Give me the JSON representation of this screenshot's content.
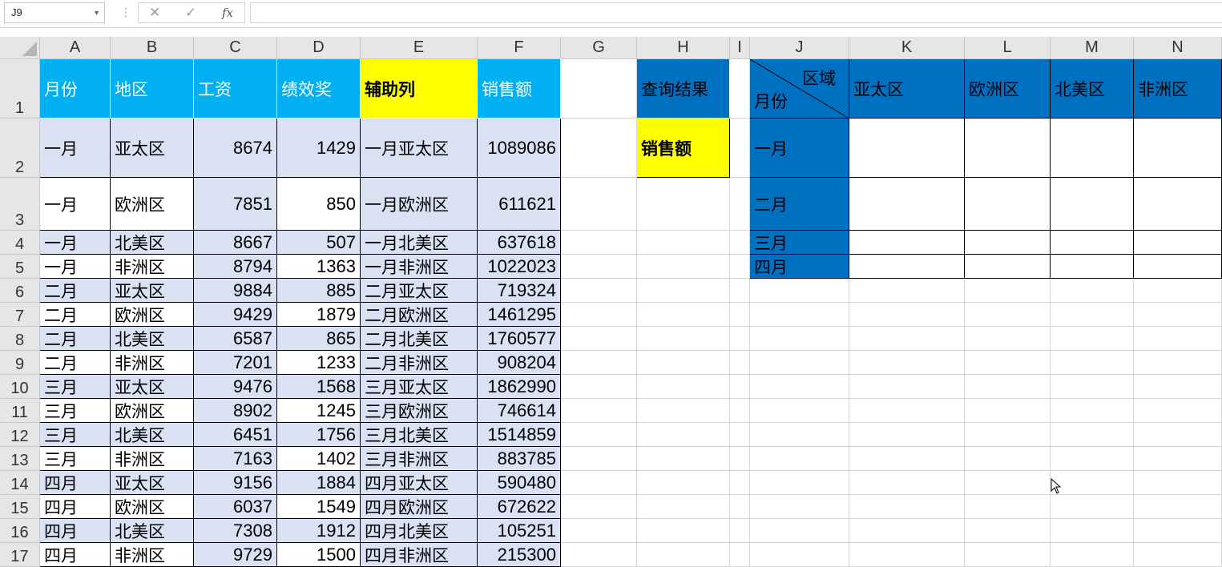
{
  "name_box": "J9",
  "formula_bar": {
    "cancel_icon": "✕",
    "enter_icon": "✓",
    "fx_label": "fx",
    "value": ""
  },
  "columns": [
    "A",
    "B",
    "C",
    "D",
    "E",
    "F",
    "G",
    "H",
    "I",
    "J",
    "K",
    "L",
    "M",
    "N"
  ],
  "rows": [
    "1",
    "2",
    "3",
    "4",
    "5",
    "6",
    "7",
    "8",
    "9",
    "10",
    "11",
    "12",
    "13",
    "14",
    "15",
    "16",
    "17"
  ],
  "colors": {
    "header_blue": "#00b0f0",
    "table_blue": "#0070c0",
    "yellow": "#ffff00",
    "band": "#d9e1f2"
  },
  "data_table": {
    "headers": [
      "月份",
      "地区",
      "工资",
      "绩效奖",
      "辅助列",
      "销售额"
    ],
    "rows": [
      [
        "一月",
        "亚太区",
        "8674",
        "1429",
        "一月亚太区",
        "1089086"
      ],
      [
        "一月",
        "欧洲区",
        "7851",
        "850",
        "一月欧洲区",
        "611621"
      ],
      [
        "一月",
        "北美区",
        "8667",
        "507",
        "一月北美区",
        "637618"
      ],
      [
        "一月",
        "非洲区",
        "8794",
        "1363",
        "一月非洲区",
        "1022023"
      ],
      [
        "二月",
        "亚太区",
        "9884",
        "885",
        "二月亚太区",
        "719324"
      ],
      [
        "二月",
        "欧洲区",
        "9429",
        "1879",
        "二月欧洲区",
        "1461295"
      ],
      [
        "二月",
        "北美区",
        "6587",
        "865",
        "二月北美区",
        "1760577"
      ],
      [
        "二月",
        "非洲区",
        "7201",
        "1233",
        "二月非洲区",
        "908204"
      ],
      [
        "三月",
        "亚太区",
        "9476",
        "1568",
        "三月亚太区",
        "1862990"
      ],
      [
        "三月",
        "欧洲区",
        "8902",
        "1245",
        "三月欧洲区",
        "746614"
      ],
      [
        "三月",
        "北美区",
        "6451",
        "1756",
        "三月北美区",
        "1514859"
      ],
      [
        "三月",
        "非洲区",
        "7163",
        "1402",
        "三月非洲区",
        "883785"
      ],
      [
        "四月",
        "亚太区",
        "9156",
        "1884",
        "四月亚太区",
        "590480"
      ],
      [
        "四月",
        "欧洲区",
        "6037",
        "1549",
        "四月欧洲区",
        "672622"
      ],
      [
        "四月",
        "北美区",
        "7308",
        "1912",
        "四月北美区",
        "105251"
      ],
      [
        "四月",
        "非洲区",
        "9729",
        "1500",
        "四月非洲区",
        "215300"
      ]
    ]
  },
  "query": {
    "title": "查询结果",
    "field": "销售额"
  },
  "result_table": {
    "corner_top": "区域",
    "corner_bottom": "月份",
    "regions": [
      "亚太区",
      "欧洲区",
      "北美区",
      "非洲区"
    ],
    "months": [
      "一月",
      "二月",
      "三月",
      "四月"
    ]
  }
}
